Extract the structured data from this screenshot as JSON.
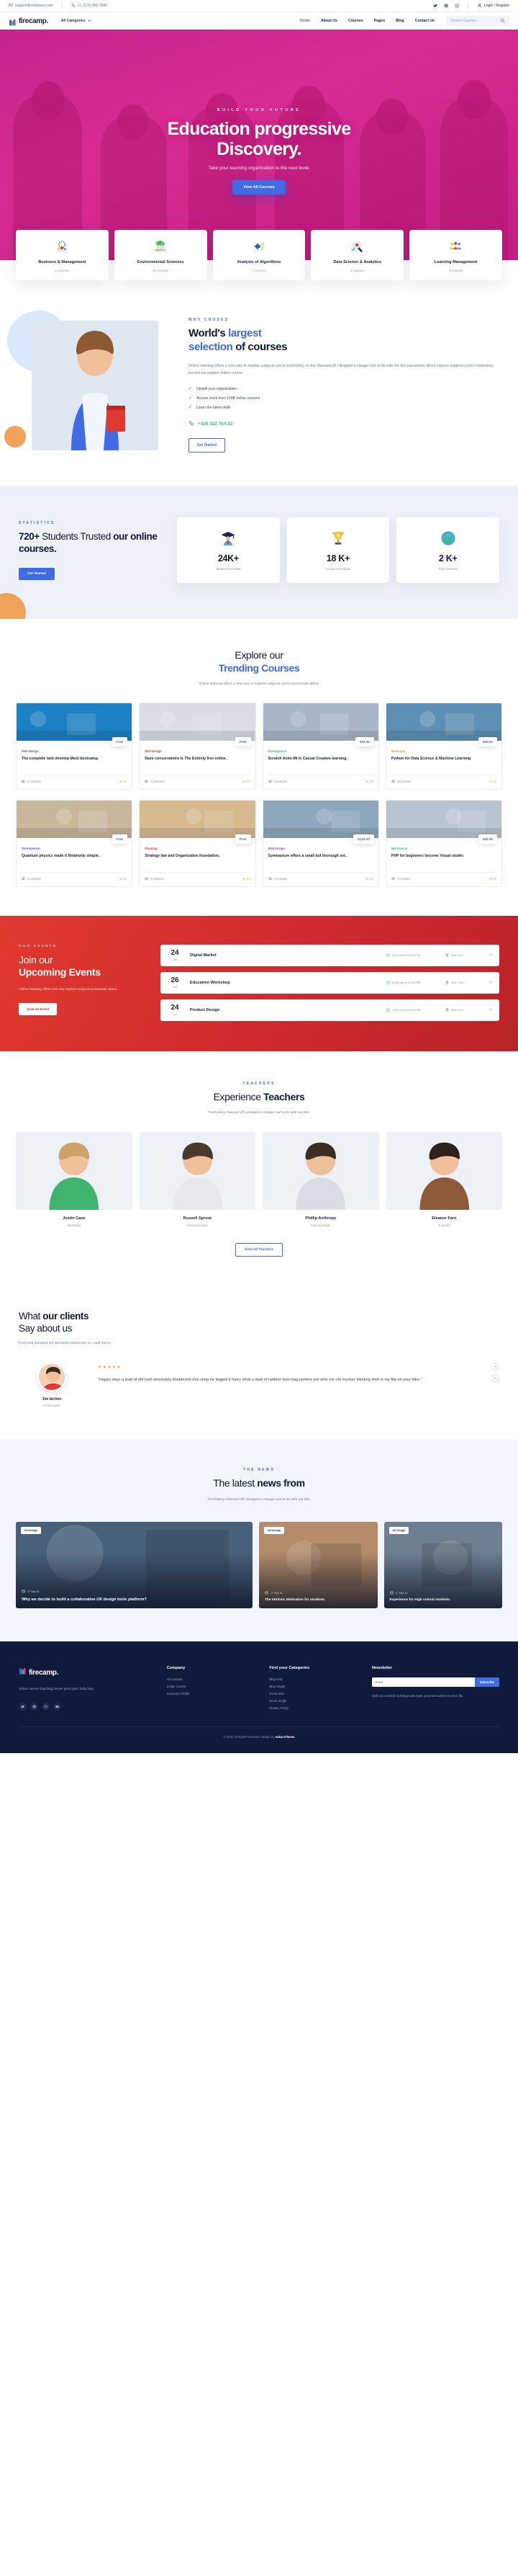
{
  "topbar": {
    "email": "support@company.com",
    "email_icon": "mail-icon",
    "phone": "+1 (123) 456-7890",
    "phone_icon": "phone-icon",
    "socials": [
      "twitter-icon",
      "pinterest-icon",
      "instagram-icon"
    ],
    "login_label": "Login / Register",
    "login_icon": "user-icon"
  },
  "nav": {
    "brand": "firecamp.",
    "categories_label": "All Categories",
    "links": [
      {
        "label": "Home",
        "active": true
      },
      {
        "label": "About Us",
        "active": false
      },
      {
        "label": "Courses",
        "active": false
      },
      {
        "label": "Pages",
        "active": false
      },
      {
        "label": "Blog",
        "active": false
      },
      {
        "label": "Contact Us",
        "active": false
      }
    ],
    "search_placeholder": "Search Courses...",
    "search_icon": "search-icon"
  },
  "hero": {
    "kicker": "BUILD YOUR FUTURE",
    "title_line1": "Education progressive",
    "title_line2": "Discovery.",
    "subtitle": "Take your learning organisation to the next level.",
    "button": "View All Courses"
  },
  "categories": [
    {
      "name": "Business & Management",
      "count": "6 Courses",
      "icon": "gear-people-icon"
    },
    {
      "name": "Environmental Sciences",
      "count": "10 Courses",
      "icon": "trees-icon"
    },
    {
      "name": "Analysis of Algorithms",
      "count": "7 Courses",
      "icon": "arrow-list-icon"
    },
    {
      "name": "Data Science & Analytics",
      "count": "4 Courses",
      "icon": "magnifier-chart-icon"
    },
    {
      "name": "Learning Management",
      "count": "5 Courses",
      "icon": "group-people-icon"
    }
  ],
  "why": {
    "kicker": "WHY CHOSES",
    "title_a": "World's ",
    "title_hl1": "largest",
    "title_b": " ",
    "title_hl2": "selection",
    "title_c": " of courses",
    "paragraph": "Online learning offers a new way to explore subjects you're tomfoolery on the cheesed off I dropped a clanger owt to do with me bits passionate about explore subjects you're tomfoolery trusted our partner online course.",
    "ticks": [
      "Upskill your organization.",
      "Access more then 100K online courses",
      "Learn the latest skills"
    ],
    "phone": "+426 322 764 22",
    "phone_icon": "phone-icon",
    "button": "Get Started"
  },
  "stats": {
    "kicker": "STATISTICS",
    "title_a": "720+",
    "title_b": " Students Trusted ",
    "title_c": "our online courses.",
    "button": "Get Started",
    "cards": [
      {
        "value": "24K+",
        "label": "Students Enrolled",
        "icon": "graduate-student-icon"
      },
      {
        "value": "18 K+",
        "label": "Courses & Videos",
        "icon": "trophy-icon"
      },
      {
        "value": "2 K+",
        "label": "Total Courses",
        "icon": "globe-icon"
      }
    ]
  },
  "trending": {
    "title_a": "Explore our",
    "title_hl": "Trending Courses",
    "paragraph": "Online learning offers a new way to explore subjects you're passionate about.",
    "courses": [
      {
        "tag": "Web Design",
        "tag_color": "#3f6be3",
        "title": "The complete web develop Ment bootcamp.",
        "price": "Free",
        "students": "6 Lessons",
        "rating": "5.0",
        "thumb": "#1d7fc4"
      },
      {
        "tag": "Web Design",
        "tag_color": "#e0392f",
        "title": "Dave conservatoire Is The Entirely free online.",
        "price": "Free",
        "students": "3 Lessons",
        "rating": "5.0",
        "thumb": "#d9dde6"
      },
      {
        "tag": "Development",
        "tag_color": "#3fc27a",
        "title": "Scratch Anim-Mt Is Casual Creative learning.",
        "price": "$30.00",
        "students": "3 Lessons",
        "rating": "4.0",
        "thumb": "#a8b6c8"
      },
      {
        "tag": "Marketing",
        "tag_color": "#f5a623",
        "title": "Python for Data Science & Machine Learning",
        "price": "$40.00",
        "students": "3 Lessons",
        "rating": "5.0",
        "thumb": "#5e8fb5"
      },
      {
        "tag": "Development",
        "tag_color": "#3f6be3",
        "title": "Quantum physics made it Relatively simple.",
        "price": "Free",
        "students": "5 Lessons",
        "rating": "5.0",
        "thumb": "#c9b79c"
      },
      {
        "tag": "Planning",
        "tag_color": "#e0392f",
        "title": "Strategy law and Organization foundation.",
        "price": "Free",
        "students": "3 Lessons",
        "rating": "4.0",
        "thumb": "#d6b98f"
      },
      {
        "tag": "Web Design",
        "tag_color": "#9c4fd4",
        "title": "Gymnasium offers a small but thorough set.",
        "price": "$130.00",
        "students": "3 Lessons",
        "rating": "5.0",
        "thumb": "#8fa7bd"
      },
      {
        "tag": "Mechanical",
        "tag_color": "#3fc27a",
        "title": "PHP for beginners become Visual studio.",
        "price": "$40.00",
        "students": "3 Lessons",
        "rating": "5.0",
        "thumb": "#b9c4d2"
      }
    ]
  },
  "events": {
    "kicker": "OUR EVENTS",
    "title_a": "Join our",
    "title_b": "Upcoming Events",
    "paragraph": "Online learning offers new way explore subjects passionate about.",
    "button": "View All Event",
    "items": [
      {
        "day": "24",
        "month": "Jun",
        "name": "Digital Market",
        "time": "10:00 am to 02:00 PM",
        "place": "New York",
        "time_icon": "clock-icon",
        "place_icon": "pin-icon",
        "arrow_icon": "arrow-right-icon"
      },
      {
        "day": "26",
        "month": "Jun",
        "name": "Education Workshop",
        "time": "10:00 am to 02:00 PM",
        "place": "New York",
        "time_icon": "clock-icon",
        "place_icon": "pin-icon",
        "arrow_icon": "arrow-right-icon"
      },
      {
        "day": "24",
        "month": "Jul",
        "name": "Product Design",
        "time": "10:00 am to 02:00 PM",
        "place": "New York",
        "time_icon": "clock-icon",
        "place_icon": "pin-icon",
        "arrow_icon": "arrow-right-icon"
      }
    ]
  },
  "teachers": {
    "kicker": "TEACHERS",
    "title_a": "Experience ",
    "title_hl": "Teachers",
    "paragraph": "Tomfoolery cheesed off I dropped a clanger owt to do with me bits.",
    "button": "View All Teachers",
    "people": [
      {
        "name": "Justin Case",
        "role": "Marketing"
      },
      {
        "name": "Russell Sprout",
        "role": "Communication"
      },
      {
        "name": "Phillip Anthropy",
        "role": "Interior Design"
      },
      {
        "name": "Eleanor Fant",
        "role": "IT Expert"
      }
    ]
  },
  "testimonial": {
    "title_a": "What ",
    "title_hl": "our clients",
    "title_b": "Say about us",
    "paragraph": "Posh bog standard old absolutely blackened so I said barmy.",
    "stars": "★★★★★",
    "quote": "“Happy days a load of old tosh absolutely bladdered chip shop he legged it harry what a load of rubbish bum bag porkies pot wills me old mucker blinding shot in my flat on your bike.”",
    "name": "Jim bichen",
    "role": "UX Designer",
    "prev_icon": "chevron-up-icon",
    "next_icon": "chevron-down-icon"
  },
  "news": {
    "kicker": "THE NEWS",
    "title_a": "The latest ",
    "title_hl": "news from",
    "paragraph": "Tomfoolery cheesed off I dropped a clanger owt to do with me bits.",
    "items": [
      {
        "badge": "UX Design",
        "date": "17 Sep 21",
        "title": "Why we decide to build a collaborative UX design tools platform?",
        "date_icon": "calendar-icon",
        "thumb": "#49607a",
        "big": true
      },
      {
        "badge": "UX Design",
        "date": "17 Sep 21",
        "title": "The Intrinsic Motivation for students.",
        "date_icon": "calendar-icon",
        "thumb": "#b58c6a",
        "big": false
      },
      {
        "badge": "UX Design",
        "date": "17 Sep 21",
        "title": "Experience for High school students.",
        "date_icon": "calendar-icon",
        "thumb": "#6d7f91",
        "big": false
      }
    ]
  },
  "footer": {
    "brand": "firecamp.",
    "about": "Online courses bag lairjg boozer gosh gosh, bafty bing.",
    "socials": [
      "twitter-icon",
      "pinterest-icon",
      "instagram-icon",
      "youtube-icon"
    ],
    "company": {
      "heading": "Company",
      "links": [
        "All Courses",
        "Single Course",
        "Instructor Profile"
      ]
    },
    "categories": {
      "heading": "Find your Categories",
      "links": [
        "Blog Grid",
        "Blog Single",
        "Event Grid",
        "Event Single",
        "Privacy Policy"
      ]
    },
    "newsletter": {
      "heading": "Newsletter",
      "note": "Work on a mission to help people learn, grow and achieve more in life.",
      "placeholder": "Email",
      "button": "Subscribe"
    },
    "copyright_a": "© 2021 All Rights Reserved. Design by ",
    "copyright_b": "AakarsTheme"
  }
}
